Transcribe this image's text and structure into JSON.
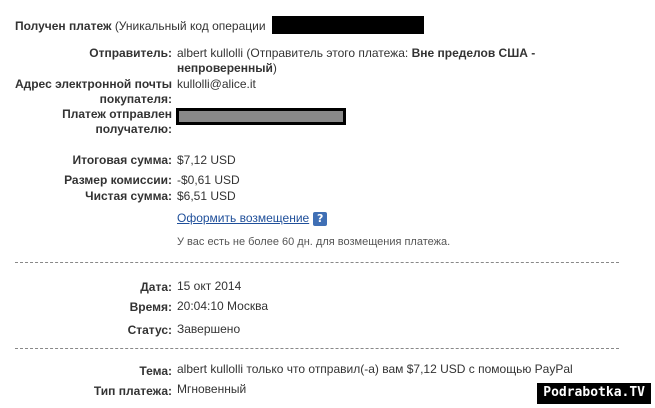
{
  "header": {
    "title_bold": "Получен платеж",
    "title_rest": "(Уникальный код операции"
  },
  "sender": {
    "label": "Отправитель:",
    "name": "albert kullolli",
    "note_prefix": "(Отправитель этого платежа:",
    "note_bold": "Вне пределов США - непроверенный",
    "note_suffix": ")"
  },
  "buyer_email": {
    "label_line1": "Адрес электронной почты",
    "label_line2": "покупателя:",
    "value": "kullolli@alice.it"
  },
  "payment_to": {
    "label_line1": "Платеж отправлен",
    "label_line2": "получателю:"
  },
  "amounts": {
    "total_label": "Итоговая сумма:",
    "total_value": "$7,12 USD",
    "fee_label": "Размер комиссии:",
    "fee_value": "-$0,61 USD",
    "net_label": "Чистая сумма:",
    "net_value": "$6,51 USD"
  },
  "refund": {
    "link_label": "Оформить возмещение",
    "help_glyph": "?",
    "note": "У вас есть не более 60 дн. для возмещения платежа."
  },
  "details": {
    "date_label": "Дата:",
    "date_value": "15 окт 2014",
    "time_label": "Время:",
    "time_value": "20:04:10 Москва",
    "status_label": "Статус:",
    "status_value": "Завершено"
  },
  "subject": {
    "label": "Тема:",
    "value": "albert kullolli только что отправил(-а) вам $7,12 USD с помощью PayPal"
  },
  "payment_type": {
    "label": "Тип платежа:",
    "value": "Мгновенный"
  },
  "watermark": "Podrabotka.TV"
}
